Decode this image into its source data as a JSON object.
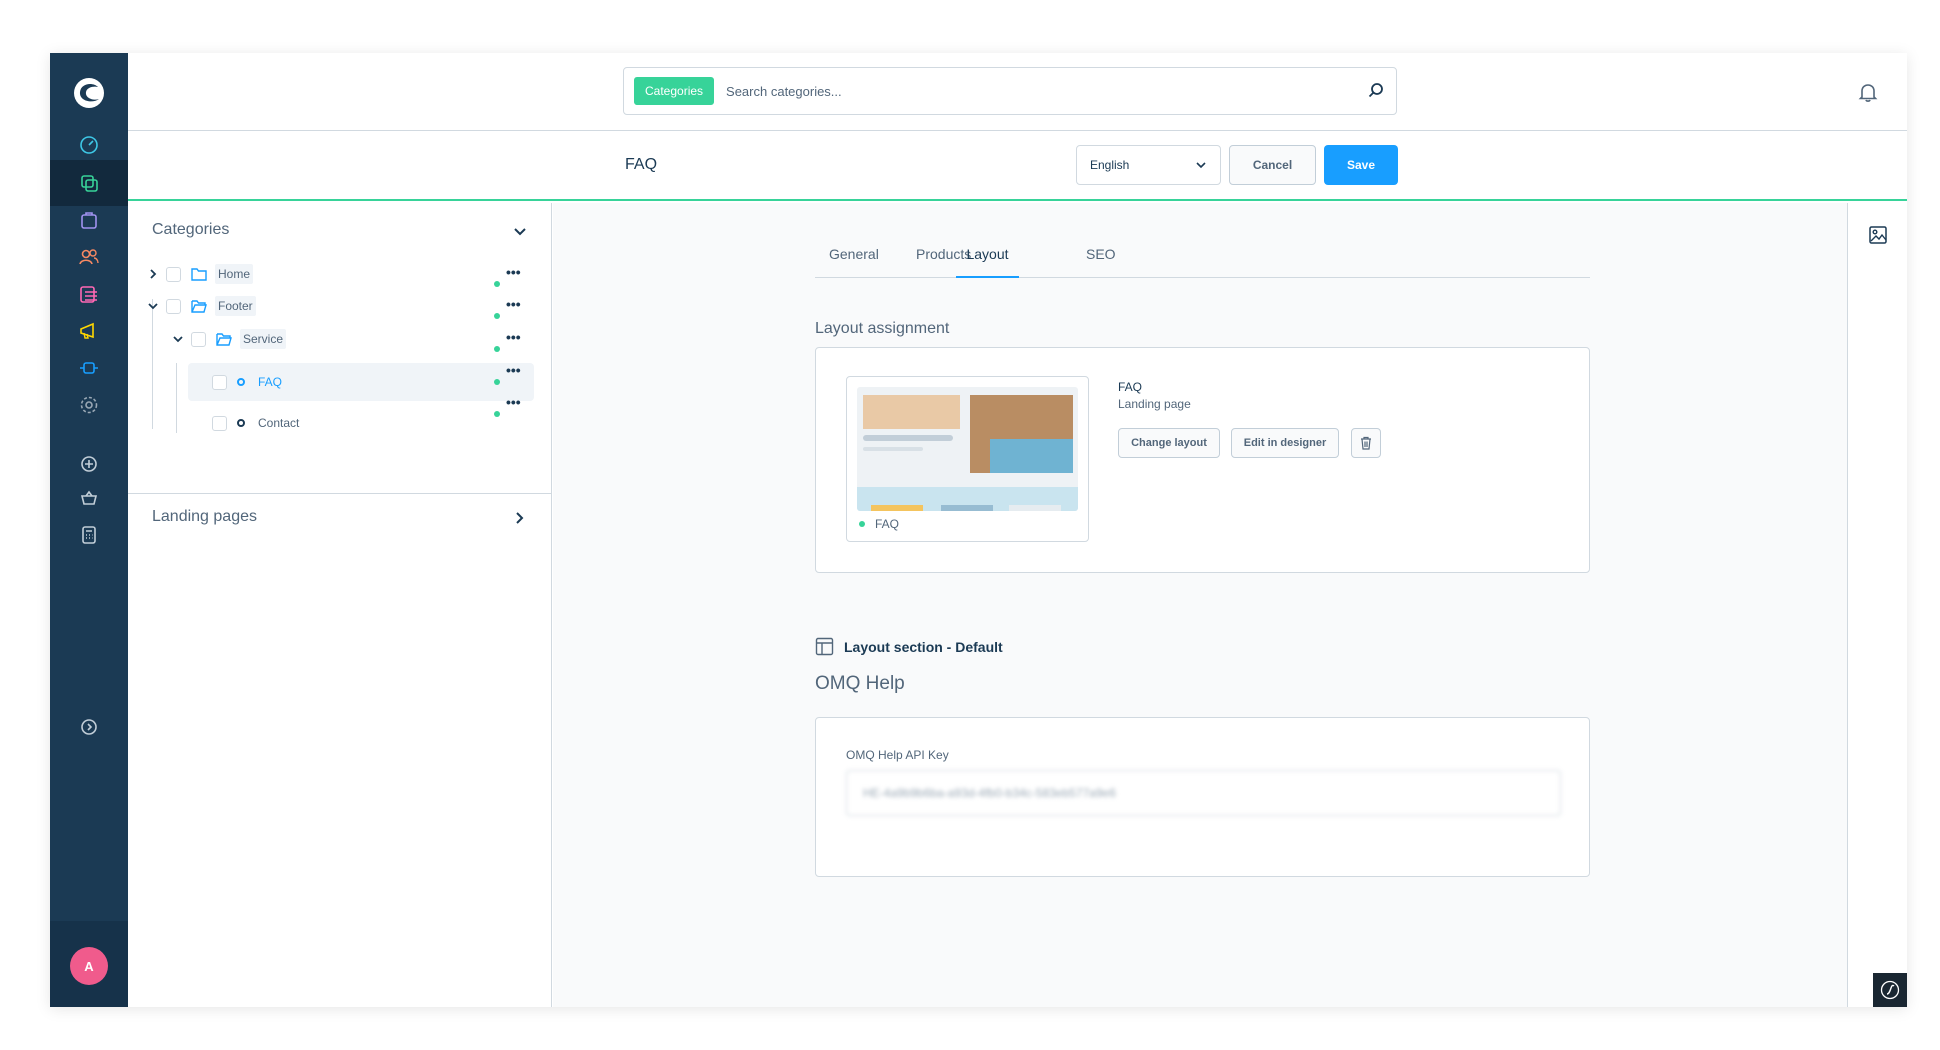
{
  "header": {
    "search_tag": "Categories",
    "search_placeholder": "Search categories..."
  },
  "smartbar": {
    "title": "FAQ",
    "language": "English",
    "cancel_label": "Cancel",
    "save_label": "Save"
  },
  "tree": {
    "heading": "Categories",
    "items": [
      {
        "label": "Home"
      },
      {
        "label": "Footer"
      },
      {
        "label": "Service"
      },
      {
        "label": "FAQ"
      },
      {
        "label": "Contact"
      }
    ],
    "more_label": "•••",
    "landing_heading": "Landing pages"
  },
  "tabs": [
    {
      "label": "General"
    },
    {
      "label": "Products"
    },
    {
      "label": "Layout"
    },
    {
      "label": "SEO"
    }
  ],
  "layout_assignment": {
    "title": "Layout assignment",
    "layout_name": "FAQ",
    "layout_type": "Landing page",
    "preview_label": "FAQ",
    "change_label": "Change layout",
    "edit_label": "Edit in designer"
  },
  "layout_section": {
    "label": "Layout section - Default",
    "block_title": "OMQ Help",
    "field_label": "OMQ Help API Key",
    "field_value": "HE-4a9b9b6ba-a93d-4fb0-b34c-583eb577a9e6"
  },
  "avatar_initial": "A",
  "colors": {
    "nav_bg": "#1b3a54",
    "accent_green": "#37d399",
    "primary_blue": "#189eff",
    "avatar_pink": "#f05b8c"
  },
  "icons": [
    "shopware-logo-icon",
    "dashboard-icon",
    "catalogue-icon",
    "orders-icon",
    "customers-icon",
    "content-icon",
    "marketing-icon",
    "extensions-icon",
    "settings-icon",
    "add-icon",
    "basket-icon",
    "calculator-icon",
    "help-icon",
    "search-icon",
    "bell-icon",
    "media-icon",
    "symfony-icon"
  ]
}
